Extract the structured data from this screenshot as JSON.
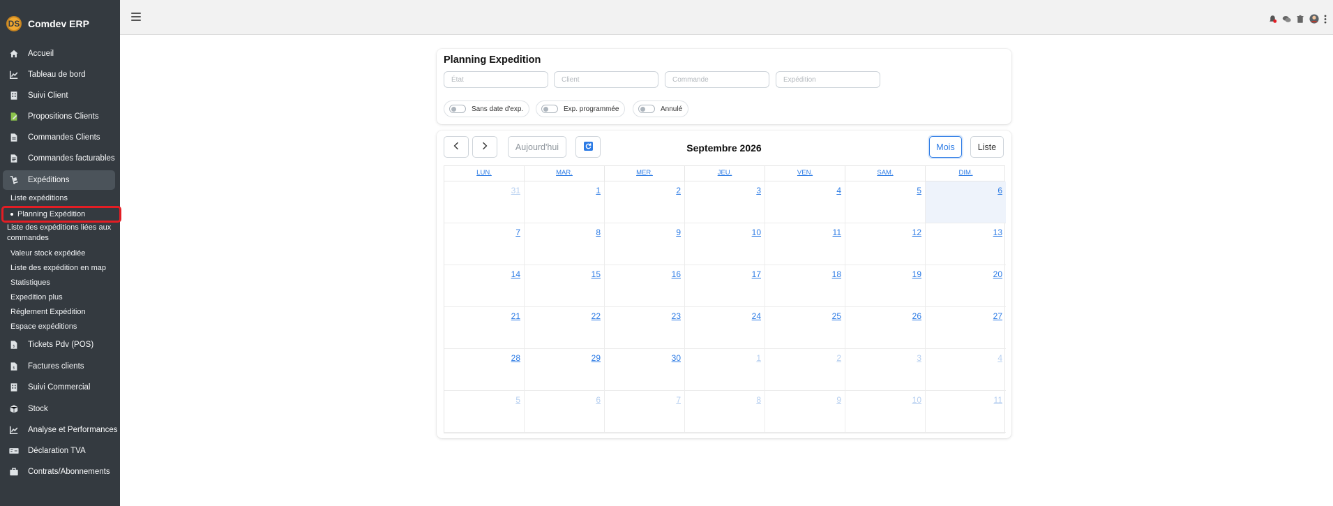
{
  "app": {
    "brand_initials": "DS",
    "brand_name": "Comdev ERP"
  },
  "sidebar": {
    "items": [
      {
        "label": "Accueil",
        "icon": "home-icon"
      },
      {
        "label": "Tableau de bord",
        "icon": "chart-line-icon"
      },
      {
        "label": "Suivi Client",
        "icon": "building-icon"
      },
      {
        "label": "Propositions Clients",
        "icon": "file-edit-icon"
      },
      {
        "label": "Commandes Clients",
        "icon": "file-icon"
      },
      {
        "label": "Commandes facturables",
        "icon": "file-invoice-icon"
      },
      {
        "label": "Expéditions",
        "icon": "dolly-icon"
      },
      {
        "label": "Tickets Pdv (POS)",
        "icon": "receipt-icon"
      },
      {
        "label": "Factures clients",
        "icon": "file-dollar-icon"
      },
      {
        "label": "Suivi Commercial",
        "icon": "building-icon"
      },
      {
        "label": "Stock",
        "icon": "box-icon"
      },
      {
        "label": "Analyse et Performances",
        "icon": "chart-line-icon"
      },
      {
        "label": "Déclaration TVA",
        "icon": "money-check-icon"
      },
      {
        "label": "Contrats/Abonnements",
        "icon": "briefcase-icon"
      }
    ],
    "active_item": "Expéditions",
    "sub_items": [
      "Liste expéditions",
      "Planning Expédition",
      "Liste des expéditions liées aux commandes",
      "Valeur stock expédiée",
      "Liste des expédition en map",
      "Statistiques",
      "Expedition plus",
      "Réglement Expédition",
      "Espace expéditions"
    ],
    "active_sub_item": "Planning Expédition"
  },
  "topbar": {
    "icons": [
      "bell-alert-icon",
      "chat-icon",
      "trash-icon",
      "user-avatar-icon",
      "more-vertical-icon"
    ]
  },
  "filters": {
    "title": "Planning Expedition",
    "inputs": [
      {
        "name": "etat",
        "placeholder": "État"
      },
      {
        "name": "client",
        "placeholder": "Client"
      },
      {
        "name": "commande",
        "placeholder": "Commande"
      },
      {
        "name": "expedition",
        "placeholder": "Expédition"
      }
    ],
    "toggles": [
      {
        "label": "Sans date d'exp.",
        "on": false
      },
      {
        "label": "Exp. programmée",
        "on": false
      },
      {
        "label": "Annulé",
        "on": false
      }
    ]
  },
  "calendar": {
    "title": "Septembre 2026",
    "today_label": "Aujourd'hui",
    "view_month": "Mois",
    "view_list": "Liste",
    "active_view": "Mois",
    "weekdays": [
      "LUN.",
      "MAR.",
      "MER.",
      "JEU.",
      "VEN.",
      "SAM.",
      "DIM."
    ],
    "weeks": [
      [
        {
          "d": "31",
          "o": true
        },
        {
          "d": "1"
        },
        {
          "d": "2"
        },
        {
          "d": "3"
        },
        {
          "d": "4"
        },
        {
          "d": "5"
        },
        {
          "d": "6",
          "today": true
        }
      ],
      [
        {
          "d": "7"
        },
        {
          "d": "8"
        },
        {
          "d": "9"
        },
        {
          "d": "10"
        },
        {
          "d": "11"
        },
        {
          "d": "12"
        },
        {
          "d": "13"
        }
      ],
      [
        {
          "d": "14"
        },
        {
          "d": "15"
        },
        {
          "d": "16"
        },
        {
          "d": "17"
        },
        {
          "d": "18"
        },
        {
          "d": "19"
        },
        {
          "d": "20"
        }
      ],
      [
        {
          "d": "21"
        },
        {
          "d": "22"
        },
        {
          "d": "23"
        },
        {
          "d": "24"
        },
        {
          "d": "25"
        },
        {
          "d": "26"
        },
        {
          "d": "27"
        }
      ],
      [
        {
          "d": "28"
        },
        {
          "d": "29"
        },
        {
          "d": "30"
        },
        {
          "d": "1",
          "o": true
        },
        {
          "d": "2",
          "o": true
        },
        {
          "d": "3",
          "o": true
        },
        {
          "d": "4",
          "o": true
        }
      ],
      [
        {
          "d": "5",
          "o": true
        },
        {
          "d": "6",
          "o": true
        },
        {
          "d": "7",
          "o": true
        },
        {
          "d": "8",
          "o": true
        },
        {
          "d": "9",
          "o": true
        },
        {
          "d": "10",
          "o": true
        },
        {
          "d": "11",
          "o": true
        }
      ]
    ]
  },
  "colors": {
    "sidebar_bg": "#343a40",
    "accent_blue": "#2c7be5",
    "highlight_red": "#e31d24"
  }
}
